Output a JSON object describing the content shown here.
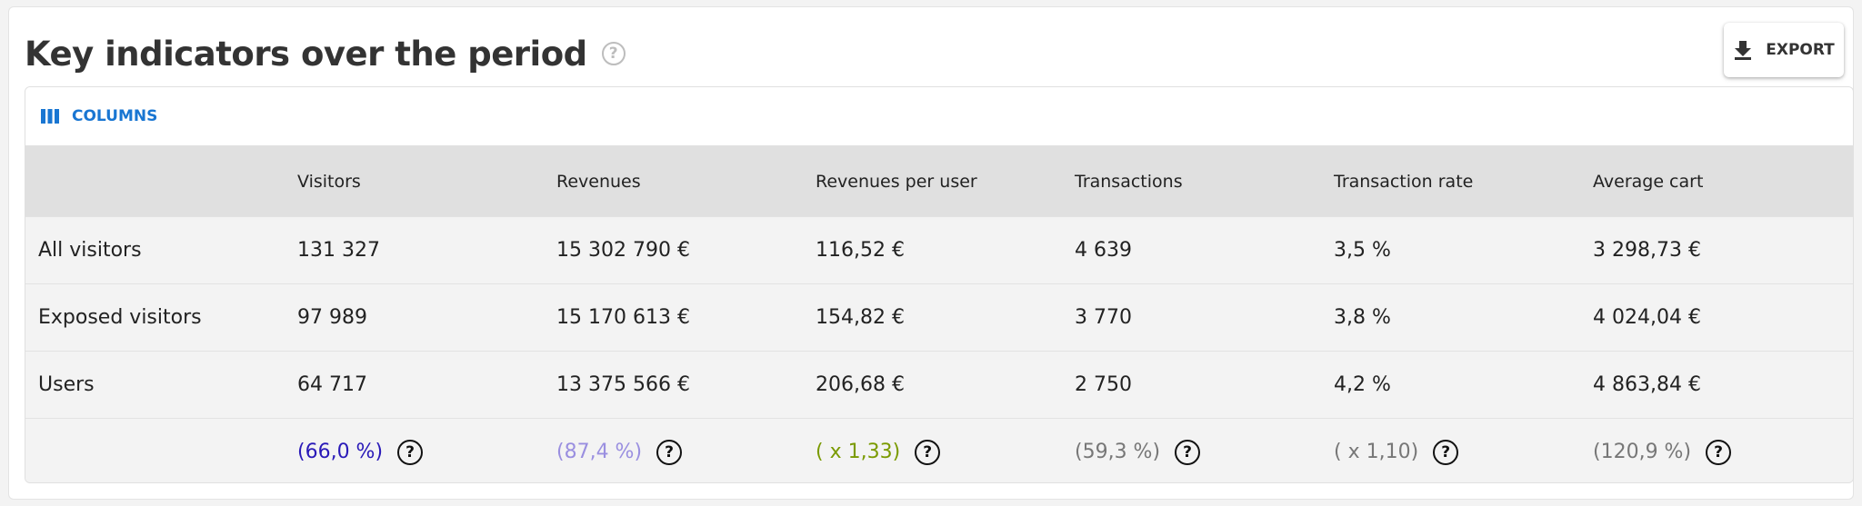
{
  "header": {
    "title": "Key indicators over the period",
    "help_icon": "?",
    "export_label": "EXPORT"
  },
  "toolbar": {
    "columns_label": "COLUMNS"
  },
  "table": {
    "columns": [
      "",
      "Visitors",
      "Revenues",
      "Revenues per user",
      "Transactions",
      "Transaction rate",
      "Average cart"
    ],
    "rows": [
      {
        "label": "All visitors",
        "values": [
          "131 327",
          "15 302 790 €",
          "116,52 €",
          "4 639",
          "3,5 %",
          "3 298,73 €"
        ]
      },
      {
        "label": "Exposed visitors",
        "values": [
          "97 989",
          "15 170 613 €",
          "154,82 €",
          "3 770",
          "3,8 %",
          "4 024,04 €"
        ]
      },
      {
        "label": "Users",
        "values": [
          "64 717",
          "13 375 566 €",
          "206,68 €",
          "2 750",
          "4,2 %",
          "4 863,84 €"
        ]
      }
    ],
    "ratios": [
      {
        "text": "(66,0 %)",
        "color": "#2a1ab8"
      },
      {
        "text": "(87,4 %)",
        "color": "#9a8fe0"
      },
      {
        "text": "( x 1,33)",
        "color": "#7a9a00"
      },
      {
        "text": "(59,3 %)",
        "color": "#777777"
      },
      {
        "text": "( x 1,10)",
        "color": "#777777"
      },
      {
        "text": "(120,9 %)",
        "color": "#777777"
      }
    ],
    "ratio_help_icon": "?"
  },
  "icons": {
    "title_help": "help-circle-icon",
    "export": "download-icon",
    "columns": "view-columns-icon",
    "ratio_help": "help-circle-icon"
  },
  "colors": {
    "accent": "#1976d2",
    "header_bg": "#e0e0e0",
    "row_bg": "#f3f3f3"
  }
}
